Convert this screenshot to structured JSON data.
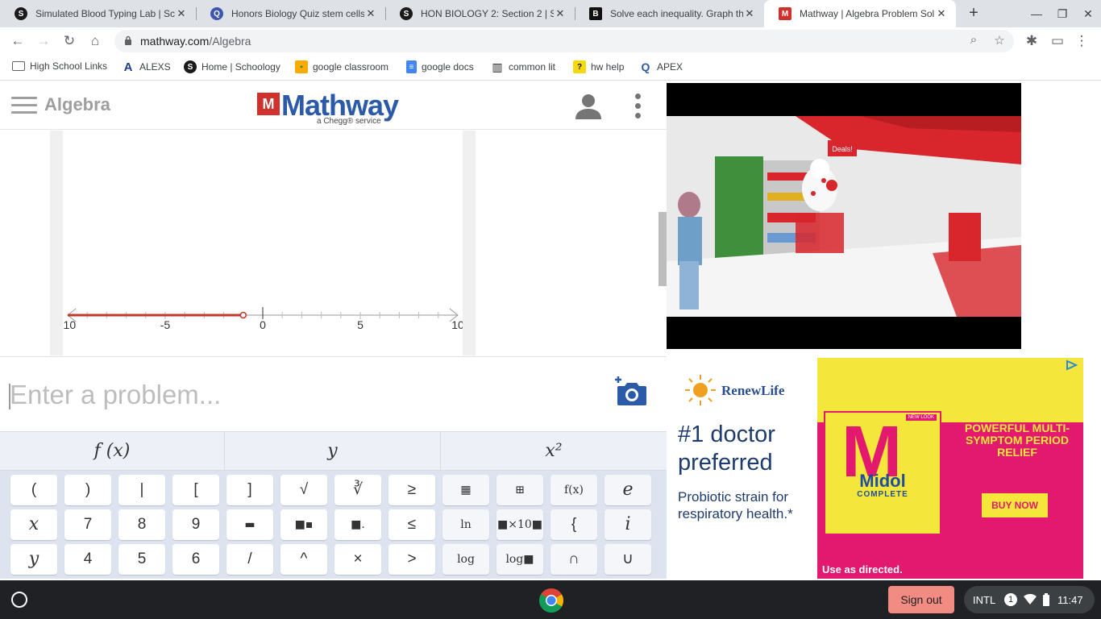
{
  "tabs": [
    {
      "title": "Simulated Blood Typing Lab | Sc",
      "favicon": "schoology-icon"
    },
    {
      "title": "Honors Biology Quiz stem cells",
      "favicon": "quizlet-icon"
    },
    {
      "title": "HON BIOLOGY 2: Section 2 | Sch",
      "favicon": "schoology-icon"
    },
    {
      "title": "Solve each inequality. Graph the",
      "favicon": "brainly-icon"
    },
    {
      "title": "Mathway | Algebra Problem Sol",
      "favicon": "mathway-icon",
      "active": true
    }
  ],
  "address": {
    "host": "mathway.com",
    "path": "/Algebra"
  },
  "bookmarks": [
    {
      "label": "High School Links",
      "icon": "folder-icon"
    },
    {
      "label": "ALEXS",
      "icon": "alexs-icon"
    },
    {
      "label": "Home | Schoology",
      "icon": "schoology-icon"
    },
    {
      "label": "google classroom",
      "icon": "classroom-icon"
    },
    {
      "label": "google docs",
      "icon": "docs-icon"
    },
    {
      "label": "common lit",
      "icon": "book-icon"
    },
    {
      "label": "hw help",
      "icon": "hw-icon"
    },
    {
      "label": "APEX",
      "icon": "apex-icon"
    }
  ],
  "mathway": {
    "section_title": "Algebra",
    "logo_text": "Mathway",
    "logo_mark": "M",
    "logo_sub": "a Chegg® service",
    "input_placeholder": "Enter a problem...",
    "key_tabs": [
      "f (x)",
      "y",
      "x²"
    ]
  },
  "numberline": {
    "ticks": [
      "-10",
      "-5",
      "0",
      "5",
      "10"
    ],
    "min": -10,
    "max": 10,
    "shaded_to": -1,
    "endpoint": "open",
    "color": "#c0392b"
  },
  "keypad_rows": [
    [
      "(",
      ")",
      "|",
      "[",
      "]",
      "√",
      "∛",
      "≥",
      "▦",
      "⊞",
      "f(x)",
      "e"
    ],
    [
      "x",
      "7",
      "8",
      "9",
      "▬",
      "■▪",
      "■.",
      "≤",
      "ln",
      "■×10■",
      "{",
      "i"
    ],
    [
      "y",
      "4",
      "5",
      "6",
      "/",
      "^",
      "×",
      ">",
      "log",
      "log■",
      "∩",
      "∪"
    ]
  ],
  "ads": {
    "renewlife": {
      "brand": "RenewLife",
      "headline": "#1 doctor preferred",
      "body": "Probiotic strain for respiratory health.*"
    },
    "midol": {
      "badge": "NEW LOOK",
      "product": "Midol",
      "product_sub": "COMPLETE",
      "headline": "POWERFUL MULTI-SYMPTOM PERIOD RELIEF",
      "cta": "BUY NOW",
      "footer": "Use as directed.",
      "box_letter": "M"
    },
    "video_store_sign": "Deals!"
  },
  "shelf": {
    "signout": "Sign out",
    "ime": "INTL",
    "notifications": "1",
    "time": "11:47"
  },
  "colors": {
    "mathway_blue": "#2b5aa8",
    "mathway_red": "#d0312d",
    "midol_pink": "#e3186f",
    "midol_yellow": "#f4e63a"
  }
}
